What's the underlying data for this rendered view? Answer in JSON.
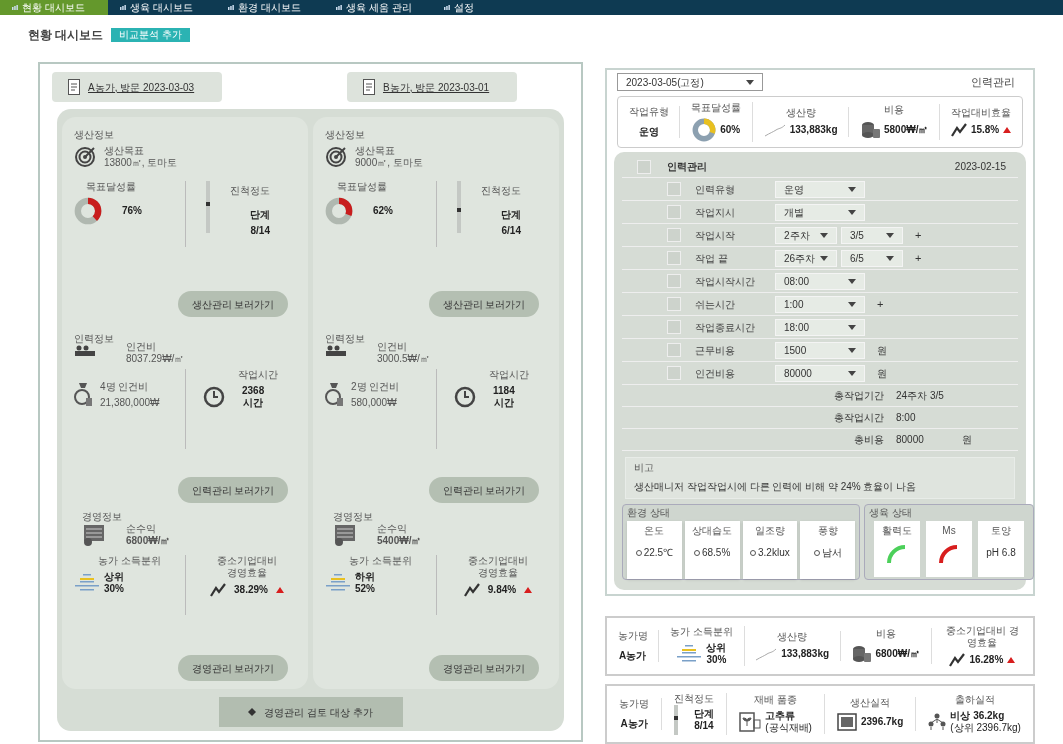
{
  "nav": [
    {
      "label": "현황 대시보드",
      "selected": true
    },
    {
      "label": "생육 대시보드",
      "selected": false
    },
    {
      "label": "환경 대시보드",
      "selected": false
    },
    {
      "label": "생육 세움 관리",
      "selected": false
    },
    {
      "label": "설정",
      "selected": false
    }
  ],
  "page_title": "현황 대시보드",
  "title_button": "비교분석 추가",
  "farms": [
    {
      "header": "A농가, 방문 2023-03-03",
      "production": {
        "section": "생산정보",
        "goal_label": "생산목표",
        "goal_value": "13800㎡, 토마토",
        "rate": {
          "label": "목표달성률",
          "value": "76%"
        },
        "progress": {
          "label": "진척정도",
          "value": "단계",
          "step": "8/14",
          "level": 0.57
        },
        "button": "생산관리 보러가기"
      },
      "labor": {
        "section": "인력정보",
        "cost_label": "인건비",
        "cost_value": "8037.29₩/㎡",
        "total_label": "4명 인건비",
        "total_value": "21,380,000₩",
        "time_label": "작업시간",
        "time_value": "2368",
        "time_unit": "시간",
        "button": "인력관리 보러가기"
      },
      "management": {
        "section": "경영정보",
        "profit_label": "순수익",
        "profit_value": "6800₩/㎡",
        "rank_label": "농가 소득분위",
        "rank_value": "상위",
        "rank_pct": "30%",
        "eff_label": "중소기업대비 경영효율",
        "eff_value": "38.29%",
        "rising": true,
        "button": "경영관리 보러가기"
      }
    },
    {
      "header": "B농가, 방문 2023-03-01",
      "production": {
        "section": "생산정보",
        "goal_label": "생산목표",
        "goal_value": "9000㎡, 토마토",
        "rate": {
          "label": "목표달성률",
          "value": "62%"
        },
        "progress": {
          "label": "진척정도",
          "value": "단계",
          "step": "6/14",
          "level": 0.43
        },
        "button": "생산관리 보러가기"
      },
      "labor": {
        "section": "인력정보",
        "cost_label": "인건비",
        "cost_value": "3000.5₩/㎡",
        "total_label": "2명 인건비",
        "total_value": "580,000₩",
        "time_label": "작업시간",
        "time_value": "1184",
        "time_unit": "시간",
        "button": "인력관리 보러가기"
      },
      "management": {
        "section": "경영정보",
        "profit_label": "순수익",
        "profit_value": "5400₩/㎡",
        "rank_label": "농가 소득분위",
        "rank_value": "하위",
        "rank_pct": "52%",
        "eff_label": "중소기업대비 경영효율",
        "eff_value": "9.84%",
        "rising": true,
        "button": "경영관리 보러가기"
      }
    }
  ],
  "add_button": "경영관리 검토 대상 추가",
  "detail": {
    "date_select": "2023-03-05(고정)",
    "title": "인력관리",
    "summary": [
      {
        "kind": "text",
        "label": "작업유형",
        "value": "운영"
      },
      {
        "kind": "donut",
        "label": "목표달성률",
        "value": "60%"
      },
      {
        "kind": "sparkline",
        "label": "생산량",
        "value": "133,883kg"
      },
      {
        "kind": "coins",
        "label": "비용",
        "value": "5800₩/㎡"
      },
      {
        "kind": "trend",
        "label": "작업대비효율",
        "value": "15.8%",
        "rising": true
      }
    ],
    "section_title": "인력관리",
    "section_date": "2023-02-15",
    "section_checked": false,
    "rows": [
      {
        "label": "인력유형",
        "checked": false,
        "selects": [
          "운영"
        ]
      },
      {
        "label": "작업지시",
        "checked": false,
        "selects": [
          "개별"
        ]
      },
      {
        "label": "작업시작",
        "checked": false,
        "selects": [
          "2주차",
          "3/5"
        ],
        "plus": "+"
      },
      {
        "label": "작업 끝",
        "checked": false,
        "selects": [
          "26주차",
          "6/5"
        ],
        "plus": "+"
      },
      {
        "label": "작업시작시간",
        "checked": false,
        "selects": [
          "08:00"
        ]
      },
      {
        "label": "쉬는시간",
        "checked": false,
        "selects": [
          "1:00"
        ],
        "plus": "+"
      },
      {
        "label": "작업종료시간",
        "checked": false,
        "selects": [
          "18:00"
        ]
      },
      {
        "label": "근무비용",
        "checked": false,
        "selects": [
          "1500"
        ],
        "unit": "원"
      },
      {
        "label": "인건비용",
        "checked": false,
        "selects": [
          "80000"
        ],
        "unit": "원"
      }
    ],
    "totals": [
      {
        "label": "총작업기간",
        "value": "24주차 3/5"
      },
      {
        "label": "총작업시간",
        "value": "8:00"
      },
      {
        "label": "총비용",
        "value": "80000",
        "unit": "원"
      }
    ],
    "memo_label": "비고",
    "memo": "생산매니저 작업작업시에 다른 인력에 비해 약 24% 효율이 나옴",
    "env": {
      "title": "환경 상태",
      "items": [
        {
          "label": "온도",
          "value": "22.5℃"
        },
        {
          "label": "상대습도",
          "value": "68.5%"
        },
        {
          "label": "일조량",
          "value": "3.2klux"
        },
        {
          "label": "풍향",
          "value": "남서"
        }
      ]
    },
    "growth": {
      "title": "생육 상태",
      "items": [
        {
          "kind": "gauge",
          "label": "활력도",
          "color": "#4cd05a"
        },
        {
          "kind": "gauge",
          "label": "Ms",
          "color": "#d81e1e"
        },
        {
          "kind": "text",
          "label": "토양",
          "value": "pH 6.8"
        }
      ]
    }
  },
  "cards": [
    {
      "items": [
        {
          "kind": "text",
          "label": "농가명",
          "value": "A농가"
        },
        {
          "kind": "rank",
          "label": "농가 소득분위",
          "value": "상위",
          "sub": "30%"
        },
        {
          "kind": "sparkline",
          "label": "생산량",
          "value": "133,883kg"
        },
        {
          "kind": "coins",
          "label": "비용",
          "value": "6800₩/㎡"
        },
        {
          "kind": "trend",
          "label": "중소기업대비 경영효율",
          "value": "16.28%",
          "rising": true
        }
      ]
    },
    {
      "items": [
        {
          "kind": "text",
          "label": "농가명",
          "value": "A농가"
        },
        {
          "kind": "progress",
          "label": "진척정도",
          "value": "단계",
          "sub": "8/14",
          "level": 0.57
        },
        {
          "kind": "plant",
          "label": "재배 품종",
          "value": "고추류",
          "sub": "(공식재배)"
        },
        {
          "kind": "chart",
          "label": "생산실적",
          "value": "2396.7kg"
        },
        {
          "kind": "people",
          "label": "출하실적",
          "value": "비상 36.2kg",
          "sub": "(상위 2396.7kg)"
        }
      ]
    }
  ]
}
